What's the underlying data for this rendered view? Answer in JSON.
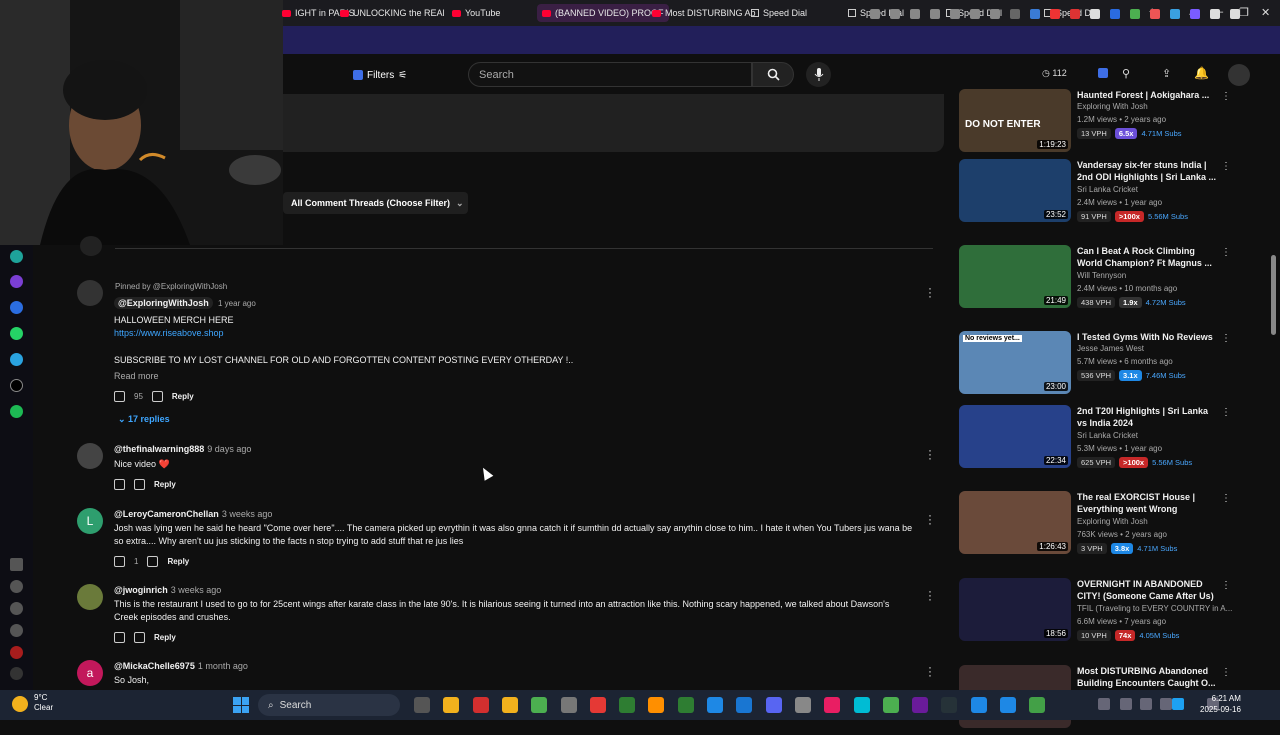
{
  "tabs": [
    {
      "label": "IGHT in PARIS",
      "icon": "youtube"
    },
    {
      "label": "UNLOCKING the REAl",
      "icon": "youtube"
    },
    {
      "label": "YouTube",
      "icon": "youtube"
    },
    {
      "label": "(BANNED VIDEO) PROOF",
      "icon": "youtube",
      "active": true
    },
    {
      "label": "Most DISTURBING Ab",
      "icon": "youtube"
    },
    {
      "label": "Speed Dial",
      "icon": "speed-dial"
    },
    {
      "label": "Speed Dial",
      "icon": "speed-dial"
    },
    {
      "label": "Speed Dial",
      "icon": "speed-dial"
    },
    {
      "label": "Speed Dial",
      "icon": "speed-dial"
    }
  ],
  "header": {
    "filters_label": "Filters",
    "search_placeholder": "Search",
    "notif_count": "112"
  },
  "sort_label": "All Comment Threads (Choose Filter)",
  "comments": [
    {
      "pinned": "Pinned by @ExploringWithJosh",
      "author": "@ExploringWithJosh",
      "time": "1 year ago",
      "lines": [
        "HALLOWEEN  MERCH HERE",
        "https://www.riseabove.shop",
        "",
        "SUBSCRIBE TO MY LOST CHANNEL FOR OLD AND FORGOTTEN CONTENT POSTING EVERY OTHERDAY !.."
      ],
      "read_more": "Read more",
      "likes": "95",
      "replies": "17 replies"
    },
    {
      "author": "@thefinalwarning888",
      "time": "9 days ago",
      "text": "Nice video ❤️",
      "likes": "",
      "avatar_color": "#444"
    },
    {
      "author": "@LeroyCameronChellan",
      "time": "3 weeks ago",
      "text": "Josh was lying wen he said he heard \"Come over here\".... The camera picked up evrythin it was also gnna catch it if sumthin dd actually say anythin close to him.. I hate it when You Tubers jus wana be so extra.... Why aren't uu jus sticking to the facts n stop trying to add stuff that re jus lies",
      "likes": "1",
      "avatar_letter": "L",
      "avatar_color": "#2e9e6e"
    },
    {
      "author": "@jwoginrich",
      "time": "3 weeks ago",
      "text": "This is the restaurant I used to go to for 25cent wings after karate class in the late 90's. It is hilarious seeing it turned into an attraction like this. Nothing scary happened, we talked about Dawson's Creek episodes and crushes.",
      "likes": "",
      "avatar_color": "#6a7a3a"
    },
    {
      "author": "@MickaChelle6975",
      "time": "1 month ago",
      "text": "So Josh,",
      "avatar_letter": "a",
      "avatar_color": "#c2185b"
    }
  ],
  "actions": {
    "reply": "Reply"
  },
  "videos": [
    {
      "title": "Haunted Forest | Aokigahara ...",
      "channel": "Exploring With Josh",
      "meta": "1.2M views • 2 years ago",
      "duration": "1:19:23",
      "vph": "13 VPH",
      "badge": "6.5x",
      "badge_color": "#6b4fd8",
      "subs": "4.71M Subs",
      "thumb": "#4a3a2a",
      "overlay": "DO NOT ENTER"
    },
    {
      "title": "Vandersay six-fer stuns India | 2nd ODI Highlights | Sri Lanka ...",
      "channel": "Sri Lanka Cricket",
      "meta": "2.4M views • 1 year ago",
      "duration": "23:52",
      "vph": "91 VPH",
      "badge": ">100x",
      "badge_color": "#c62828",
      "subs": "5.56M Subs",
      "thumb": "#1d3f6b"
    },
    {
      "title": "Can I Beat A Rock Climbing World Champion? Ft Magnus ...",
      "channel": "Will Tennyson",
      "meta": "2.4M views • 10 months ago",
      "duration": "21:49",
      "vph": "438 VPH",
      "badge": "1.9x",
      "badge_color": "#333",
      "subs": "4.72M Subs",
      "thumb": "#2f6e3a"
    },
    {
      "title": "I Tested Gyms With No Reviews",
      "channel": "Jesse James West",
      "meta": "5.7M views • 6 months ago",
      "duration": "23:00",
      "vph": "536 VPH",
      "badge": "3.1x",
      "badge_color": "#1e88e5",
      "subs": "7.46M Subs",
      "thumb": "#5b87b5",
      "overlay": "No reviews yet..."
    },
    {
      "title": "2nd T20I Highlights | Sri Lanka vs India 2024",
      "channel": "Sri Lanka Cricket",
      "meta": "5.3M views • 1 year ago",
      "duration": "22:34",
      "vph": "625 VPH",
      "badge": ">100x",
      "badge_color": "#c62828",
      "subs": "5.56M Subs",
      "thumb": "#27418a"
    },
    {
      "title": "The real EXORCIST House | Everything went Wrong",
      "channel": "Exploring With Josh",
      "meta": "763K views • 2 years ago",
      "duration": "1:26:43",
      "vph": "3 VPH",
      "badge": "3.8x",
      "badge_color": "#1e88e5",
      "subs": "4.71M Subs",
      "thumb": "#6a4a3a"
    },
    {
      "title": "OVERNIGHT IN ABANDONED CITY! (Someone Came After Us)",
      "channel": "TFIL (Traveling to EVERY COUNTRY in A...",
      "meta": "6.6M views • 7 years ago",
      "duration": "18:56",
      "vph": "10 VPH",
      "badge": "74x",
      "badge_color": "#c62828",
      "subs": "4.05M Subs",
      "thumb": "#1c1c3a"
    },
    {
      "title": "Most DISTURBING Abandoned Building Encounters Caught O...",
      "channel": "",
      "meta": "",
      "duration": "",
      "vph": "",
      "badge": "",
      "badge_color": "#333",
      "subs": "",
      "thumb": "#3a2a2a"
    }
  ],
  "taskbar": {
    "temp": "9°C",
    "weather": "Clear",
    "search": "Search",
    "time": "6:21 AM",
    "date": "2025-09-16"
  }
}
